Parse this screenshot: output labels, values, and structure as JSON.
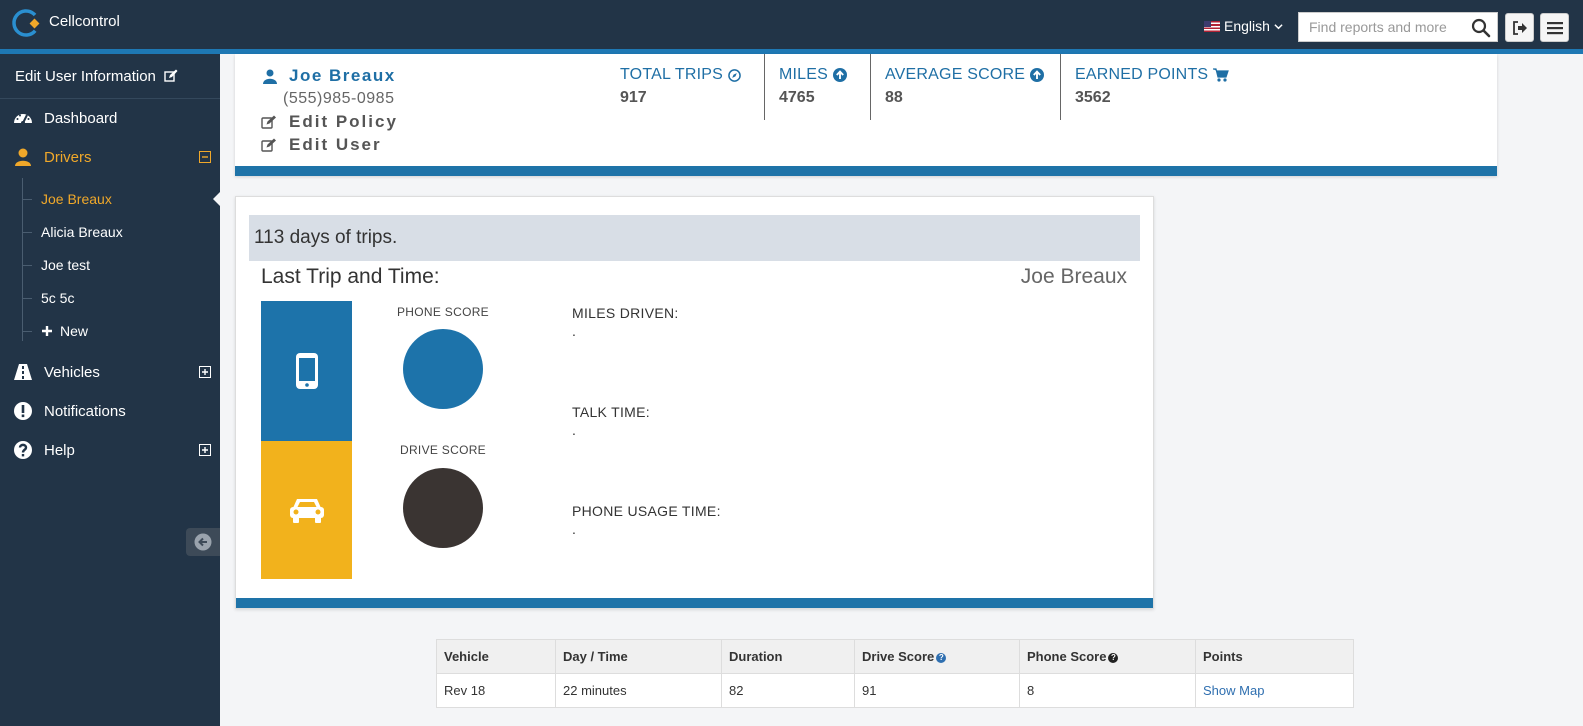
{
  "app": {
    "title": "Cellcontrol"
  },
  "topbar": {
    "language": "English",
    "search_placeholder": "Find reports and more"
  },
  "sidebar": {
    "edit_user_label": "Edit User Information",
    "items": [
      {
        "label": "Dashboard"
      },
      {
        "label": "Drivers"
      },
      {
        "label": "Vehicles"
      },
      {
        "label": "Notifications"
      },
      {
        "label": "Help"
      }
    ],
    "drivers": [
      {
        "label": "Joe Breaux"
      },
      {
        "label": "Alicia Breaux"
      },
      {
        "label": "Joe test"
      },
      {
        "label": "5c 5c"
      },
      {
        "label": "New"
      }
    ]
  },
  "profile": {
    "name": "Joe Breaux",
    "phone": "(555)985-0985",
    "edit_policy": "Edit Policy",
    "edit_user": "Edit User",
    "stats": [
      {
        "title": "TOTAL TRIPS",
        "value": "917"
      },
      {
        "title": "MILES",
        "value": "4765"
      },
      {
        "title": "AVERAGE SCORE",
        "value": "88"
      },
      {
        "title": "EARNED POINTS",
        "value": "3562"
      }
    ]
  },
  "trip_card": {
    "days_text": "113 days of trips.",
    "last_trip_label": "Last Trip and Time:",
    "driver_name": "Joe Breaux",
    "phone_score_label": "PHONE SCORE",
    "drive_score_label": "DRIVE SCORE",
    "metrics": [
      {
        "label": "MILES DRIVEN:",
        "value": "."
      },
      {
        "label": "TALK TIME:",
        "value": "."
      },
      {
        "label": "PHONE USAGE TIME:",
        "value": "."
      }
    ],
    "colors": {
      "phone_block": "#1d73aa",
      "car_block": "#f2b21c",
      "phone_score_circle": "#1d73aa",
      "drive_score_circle": "#3a3432"
    }
  },
  "table": {
    "headers": [
      "Vehicle",
      "Day / Time",
      "Duration",
      "Drive Score",
      "Phone Score",
      "Points"
    ],
    "rows": [
      [
        "Rev 18",
        "22 minutes",
        "82",
        "91",
        "8",
        "Show Map"
      ]
    ]
  },
  "icons": {
    "logo": "cellcontrol-logo-icon",
    "search": "search-icon",
    "logout": "logout-icon",
    "menu": "hamburger-menu-icon",
    "edit": "edit-icon",
    "dashboard": "dashboard-gauge-icon",
    "driver": "user-icon",
    "vehicles": "road-icon",
    "notifications": "exclamation-circle-icon",
    "help": "question-circle-icon",
    "collapse": "arrow-left-circle-icon",
    "phone": "mobile-phone-icon",
    "car": "car-icon",
    "cart": "cart-icon"
  }
}
